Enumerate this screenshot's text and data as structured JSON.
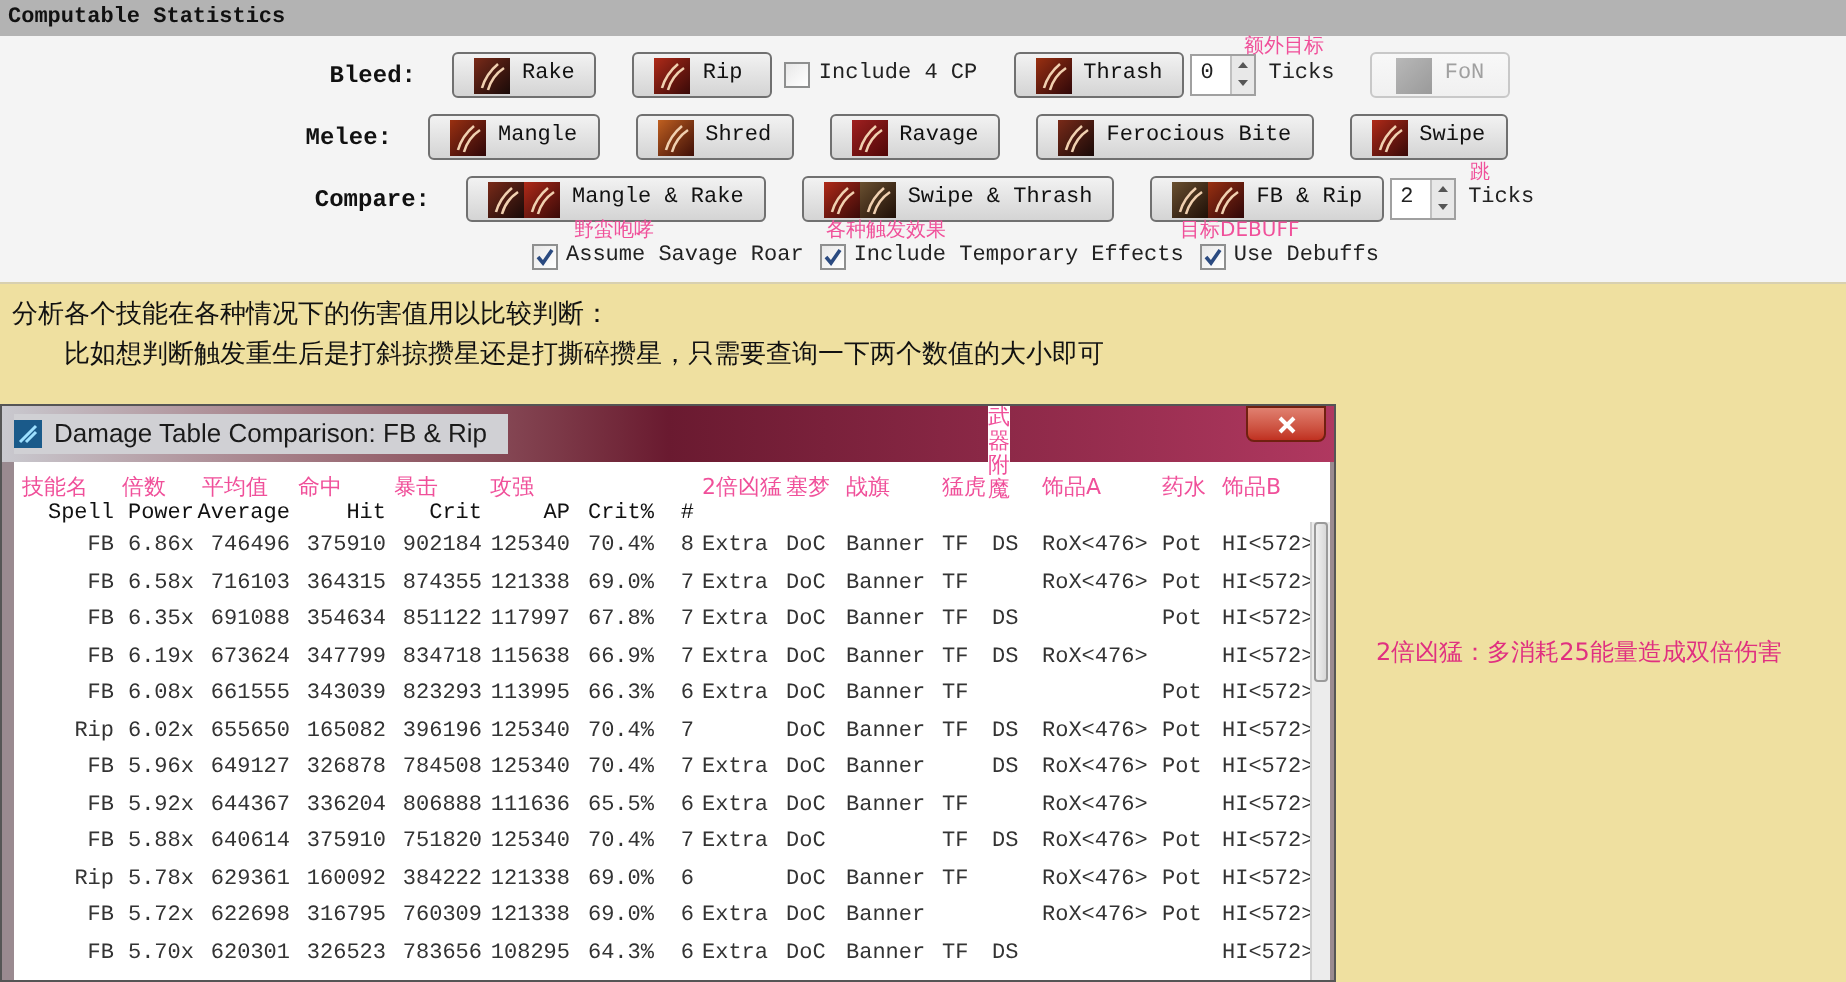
{
  "panel": {
    "title": "Computable Statistics",
    "rows": [
      {
        "label": "Bleed:",
        "items": [
          {
            "kind": "button",
            "label": "Rake",
            "disabled": false
          },
          {
            "kind": "button",
            "label": "Rip",
            "disabled": false
          },
          {
            "kind": "checkbox",
            "label": "Include 4 CP",
            "checked": false
          },
          {
            "kind": "button",
            "label": "Thrash",
            "disabled": false
          },
          {
            "kind": "spinner",
            "value": "0"
          },
          {
            "kind": "text",
            "label": "Ticks"
          },
          {
            "kind": "button",
            "label": "FoN",
            "disabled": true
          }
        ]
      },
      {
        "label": "Melee:",
        "items": [
          {
            "kind": "button",
            "label": "Mangle",
            "disabled": false
          },
          {
            "kind": "button",
            "label": "Shred",
            "disabled": false
          },
          {
            "kind": "button",
            "label": "Ravage",
            "disabled": false
          },
          {
            "kind": "button",
            "label": "Ferocious Bite",
            "disabled": false
          },
          {
            "kind": "button",
            "label": "Swipe",
            "disabled": false
          }
        ]
      },
      {
        "label": "Compare:",
        "items": [
          {
            "kind": "pair_button",
            "label": "Mangle & Rake",
            "disabled": false
          },
          {
            "kind": "pair_button",
            "label": "Swipe & Thrash",
            "disabled": false
          },
          {
            "kind": "pair_button",
            "label": "FB & Rip",
            "disabled": false
          },
          {
            "kind": "spinner",
            "value": "2"
          },
          {
            "kind": "text",
            "label": "Ticks"
          }
        ]
      }
    ],
    "options": [
      {
        "label": "Assume Savage Roar",
        "checked": true
      },
      {
        "label": "Include Temporary Effects",
        "checked": true
      },
      {
        "label": "Use Debuffs",
        "checked": true
      }
    ],
    "notes": [
      {
        "text": "额外目标"
      },
      {
        "text": "跳"
      },
      {
        "text": "野蛮咆哮"
      },
      {
        "text": "各种触发效果"
      },
      {
        "text": "目标DEBUFF"
      }
    ]
  },
  "description": [
    "分析各个技能在各种情况下的伤害值用以比较判断：",
    "比如想判断触发重生后是打斜掠攒星还是打撕碎攒星，只需要查询一下两个数值的大小即可"
  ],
  "dialog": {
    "title": "Damage Table Comparison: FB & Rip",
    "columns": [
      {
        "label": "Spell",
        "note": "技能名"
      },
      {
        "label": "Power",
        "note": "倍数"
      },
      {
        "label": "Average",
        "note": "平均值"
      },
      {
        "label": "Hit",
        "note": "命中"
      },
      {
        "label": "Crit",
        "note": "暴击"
      },
      {
        "label": "AP",
        "note": "攻强"
      },
      {
        "label": "Crit%"
      },
      {
        "label": "#"
      },
      {
        "note": "2倍凶猛"
      },
      {
        "note": "塞梦"
      },
      {
        "note": "战旗"
      },
      {
        "note": "猛虎"
      },
      {
        "note": "武器附魔"
      },
      {
        "note": "饰品A"
      },
      {
        "note": "药水"
      },
      {
        "note": "饰品B"
      }
    ],
    "rows": [
      [
        "FB",
        "6.86x",
        "746496",
        "375910",
        "902184",
        "125340",
        "70.4%",
        "8",
        "Extra",
        "DoC",
        "Banner",
        "TF",
        "DS",
        "RoX<476>",
        "Pot",
        "HI<572>"
      ],
      [
        "FB",
        "6.58x",
        "716103",
        "364315",
        "874355",
        "121338",
        "69.0%",
        "7",
        "Extra",
        "DoC",
        "Banner",
        "TF",
        null,
        "RoX<476>",
        "Pot",
        "HI<572>"
      ],
      [
        "FB",
        "6.35x",
        "691088",
        "354634",
        "851122",
        "117997",
        "67.8%",
        "7",
        "Extra",
        "DoC",
        "Banner",
        "TF",
        "DS",
        null,
        "Pot",
        "HI<572>"
      ],
      [
        "FB",
        "6.19x",
        "673624",
        "347799",
        "834718",
        "115638",
        "66.9%",
        "7",
        "Extra",
        "DoC",
        "Banner",
        "TF",
        "DS",
        "RoX<476>",
        null,
        "HI<572>"
      ],
      [
        "FB",
        "6.08x",
        "661555",
        "343039",
        "823293",
        "113995",
        "66.3%",
        "6",
        "Extra",
        "DoC",
        "Banner",
        "TF",
        null,
        null,
        "Pot",
        "HI<572>"
      ],
      [
        "Rip",
        "6.02x",
        "655650",
        "165082",
        "396196",
        "125340",
        "70.4%",
        "7",
        null,
        "DoC",
        "Banner",
        "TF",
        "DS",
        "RoX<476>",
        "Pot",
        "HI<572>"
      ],
      [
        "FB",
        "5.96x",
        "649127",
        "326878",
        "784508",
        "125340",
        "70.4%",
        "7",
        "Extra",
        "DoC",
        "Banner",
        null,
        "DS",
        "RoX<476>",
        "Pot",
        "HI<572>"
      ],
      [
        "FB",
        "5.92x",
        "644367",
        "336204",
        "806888",
        "111636",
        "65.5%",
        "6",
        "Extra",
        "DoC",
        "Banner",
        "TF",
        null,
        "RoX<476>",
        null,
        "HI<572>"
      ],
      [
        "FB",
        "5.88x",
        "640614",
        "375910",
        "751820",
        "125340",
        "70.4%",
        "7",
        "Extra",
        "DoC",
        null,
        "TF",
        "DS",
        "RoX<476>",
        "Pot",
        "HI<572>"
      ],
      [
        "Rip",
        "5.78x",
        "629361",
        "160092",
        "384222",
        "121338",
        "69.0%",
        "6",
        null,
        "DoC",
        "Banner",
        "TF",
        null,
        "RoX<476>",
        "Pot",
        "HI<572>"
      ],
      [
        "FB",
        "5.72x",
        "622698",
        "316795",
        "760309",
        "121338",
        "69.0%",
        "6",
        "Extra",
        "DoC",
        "Banner",
        null,
        null,
        "RoX<476>",
        "Pot",
        "HI<572>"
      ],
      [
        "FB",
        "5.70x",
        "620301",
        "326523",
        "783656",
        "108295",
        "64.3%",
        "6",
        "Extra",
        "DoC",
        "Banner",
        "TF",
        "DS",
        null,
        null,
        "HI<572>"
      ]
    ]
  },
  "side_note": "2倍凶猛：多消耗25能量造成双倍伤害"
}
